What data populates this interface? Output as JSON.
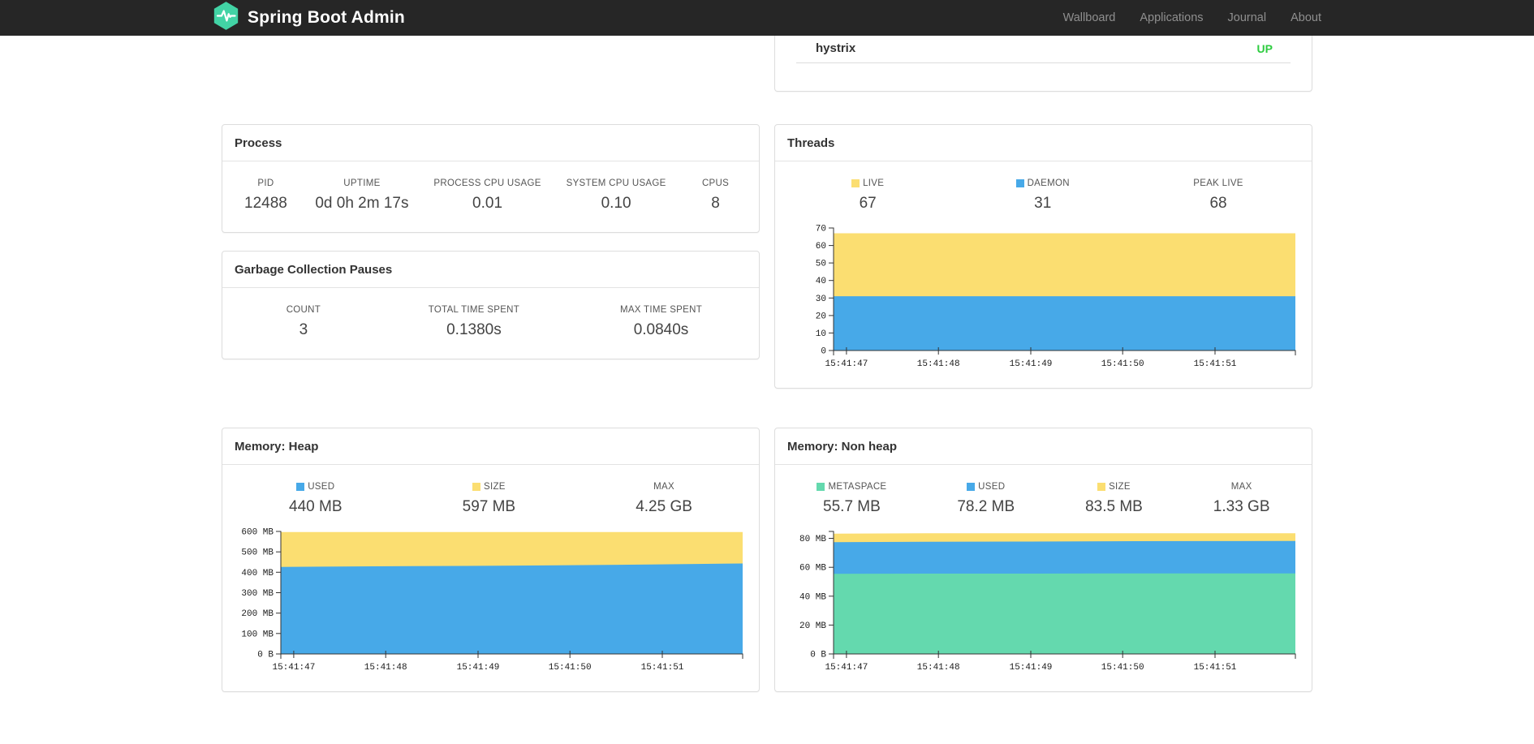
{
  "theme": {
    "navbar_bg": "#262626",
    "brand_green": "#42d3a5",
    "status_up_color": "#2ecc40",
    "chart_yellow": "#fbde71",
    "chart_blue": "#47a9e8",
    "chart_green": "#64d9ae"
  },
  "navbar": {
    "brand": "Spring Boot Admin",
    "links": [
      {
        "label": "Wallboard"
      },
      {
        "label": "Applications"
      },
      {
        "label": "Journal"
      },
      {
        "label": "About"
      }
    ]
  },
  "application_row": {
    "name": "hystrix",
    "status": "UP",
    "status_color": "#2ecc40"
  },
  "panels": {
    "process": {
      "title": "Process",
      "stats": [
        {
          "label": "PID",
          "value": "12488"
        },
        {
          "label": "UPTIME",
          "value": "0d 0h 2m 17s"
        },
        {
          "label": "PROCESS CPU USAGE",
          "value": "0.01"
        },
        {
          "label": "SYSTEM CPU USAGE",
          "value": "0.10"
        },
        {
          "label": "CPUS",
          "value": "8"
        }
      ]
    },
    "gc": {
      "title": "Garbage Collection Pauses",
      "stats": [
        {
          "label": "COUNT",
          "value": "3"
        },
        {
          "label": "TOTAL TIME SPENT",
          "value": "0.1380s"
        },
        {
          "label": "MAX TIME SPENT",
          "value": "0.0840s"
        }
      ]
    },
    "threads": {
      "title": "Threads",
      "stats": [
        {
          "label": "LIVE",
          "value": "67",
          "swatch": "#fbde71"
        },
        {
          "label": "DAEMON",
          "value": "31",
          "swatch": "#47a9e8"
        },
        {
          "label": "PEAK LIVE",
          "value": "68"
        }
      ]
    },
    "heap": {
      "title": "Memory: Heap",
      "stats": [
        {
          "label": "USED",
          "value": "440 MB",
          "swatch": "#47a9e8"
        },
        {
          "label": "SIZE",
          "value": "597 MB",
          "swatch": "#fbde71"
        },
        {
          "label": "MAX",
          "value": "4.25 GB"
        }
      ]
    },
    "nonheap": {
      "title": "Memory: Non heap",
      "stats": [
        {
          "label": "METASPACE",
          "value": "55.7 MB",
          "swatch": "#64d9ae"
        },
        {
          "label": "USED",
          "value": "78.2 MB",
          "swatch": "#47a9e8"
        },
        {
          "label": "SIZE",
          "value": "83.5 MB",
          "swatch": "#fbde71"
        },
        {
          "label": "MAX",
          "value": "1.33 GB"
        }
      ]
    }
  },
  "chart_data": [
    {
      "type": "area",
      "title": "Threads",
      "x_tick_labels": [
        "15:41:47",
        "15:41:48",
        "15:41:49",
        "15:41:50",
        "15:41:51"
      ],
      "ylim": [
        0,
        70
      ],
      "yticks": [
        {
          "v": 0,
          "label": "0"
        },
        {
          "v": 10,
          "label": "10"
        },
        {
          "v": 20,
          "label": "20"
        },
        {
          "v": 30,
          "label": "30"
        },
        {
          "v": 40,
          "label": "40"
        },
        {
          "v": 50,
          "label": "50"
        },
        {
          "v": 60,
          "label": "60"
        },
        {
          "v": 70,
          "label": "70"
        }
      ],
      "grid": false,
      "legend_position": "in-stats-row",
      "series": [
        {
          "name": "LIVE",
          "color": "#fbde71",
          "values": [
            67,
            67,
            67,
            67,
            67,
            67
          ]
        },
        {
          "name": "DAEMON",
          "color": "#47a9e8",
          "values": [
            31,
            31,
            31,
            31,
            31,
            31
          ]
        }
      ]
    },
    {
      "type": "area",
      "title": "Memory: Heap",
      "x_tick_labels": [
        "15:41:47",
        "15:41:48",
        "15:41:49",
        "15:41:50",
        "15:41:51"
      ],
      "ylim": [
        0,
        600
      ],
      "yticks": [
        {
          "v": 0,
          "label": "0 B"
        },
        {
          "v": 100,
          "label": "100 MB"
        },
        {
          "v": 200,
          "label": "200 MB"
        },
        {
          "v": 300,
          "label": "300 MB"
        },
        {
          "v": 400,
          "label": "400 MB"
        },
        {
          "v": 500,
          "label": "500 MB"
        },
        {
          "v": 600,
          "label": "600 MB"
        }
      ],
      "grid": false,
      "legend_position": "in-stats-row",
      "series": [
        {
          "name": "SIZE",
          "color": "#fbde71",
          "values": [
            597,
            597,
            597,
            597,
            597,
            597
          ]
        },
        {
          "name": "USED",
          "color": "#47a9e8",
          "values": [
            426,
            429,
            431,
            434,
            438,
            443
          ]
        }
      ]
    },
    {
      "type": "area",
      "title": "Memory: Non heap",
      "x_tick_labels": [
        "15:41:47",
        "15:41:48",
        "15:41:49",
        "15:41:50",
        "15:41:51"
      ],
      "ylim": [
        0,
        84.8
      ],
      "yticks": [
        {
          "v": 0,
          "label": "0 B"
        },
        {
          "v": 20,
          "label": "20 MB"
        },
        {
          "v": 40,
          "label": "40 MB"
        },
        {
          "v": 60,
          "label": "60 MB"
        },
        {
          "v": 80,
          "label": "80 MB"
        }
      ],
      "grid": false,
      "legend_position": "in-stats-row",
      "series": [
        {
          "name": "SIZE",
          "color": "#fbde71",
          "values": [
            83.2,
            83.5,
            83.5,
            83.5,
            83.5,
            83.5
          ]
        },
        {
          "name": "USED",
          "color": "#47a9e8",
          "values": [
            77.4,
            77.6,
            77.8,
            78.0,
            78.1,
            78.2
          ]
        },
        {
          "name": "METASPACE",
          "color": "#64d9ae",
          "values": [
            55.5,
            55.6,
            55.6,
            55.7,
            55.7,
            55.7
          ]
        }
      ]
    }
  ]
}
